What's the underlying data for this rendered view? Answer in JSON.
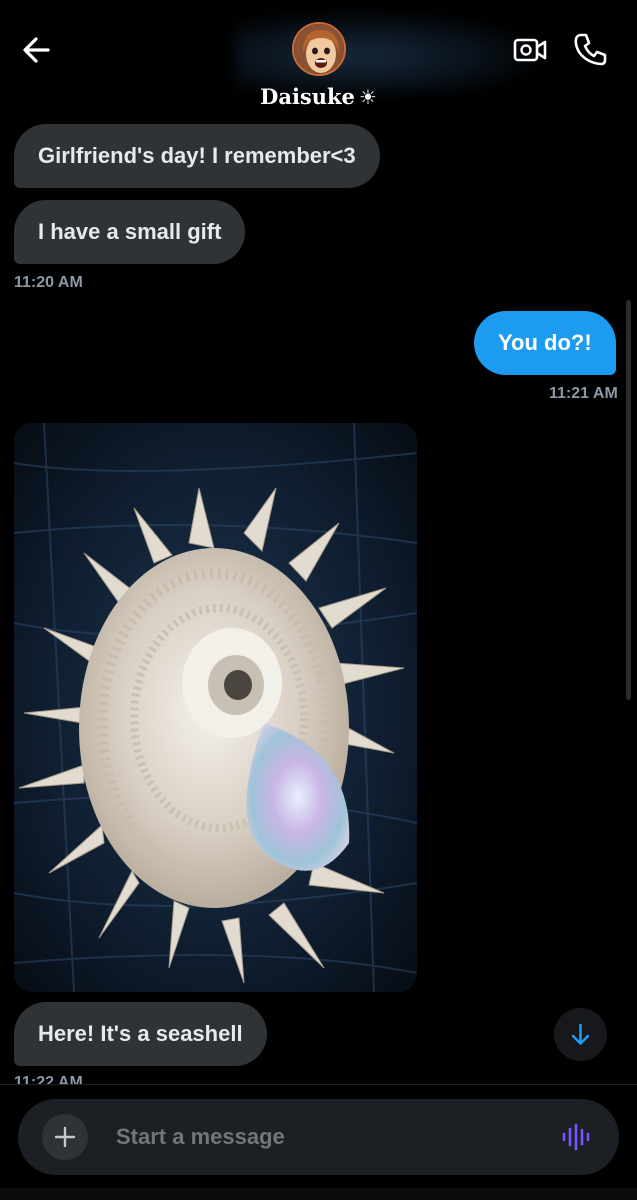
{
  "header": {
    "contact_name": "Daisuke",
    "name_emoji": "☀"
  },
  "messages": [
    {
      "direction": "in",
      "text": "Girlfriend's day! I remember<3"
    },
    {
      "direction": "in",
      "text": "I have a small gift"
    },
    {
      "direction": "in",
      "timestamp": "11:20 AM"
    },
    {
      "direction": "out",
      "text": "You do?!"
    },
    {
      "direction": "out",
      "timestamp": "11:21 AM"
    },
    {
      "direction": "in",
      "media": "spiral seashell photo"
    },
    {
      "direction": "in",
      "text": "Here! It's a seashell"
    },
    {
      "direction": "in",
      "timestamp": "11:22 AM"
    }
  ],
  "composer": {
    "placeholder": "Start a message"
  },
  "icons": {
    "back": "arrow-left-icon",
    "video": "video-camera-icon",
    "call": "phone-icon",
    "add": "plus-icon",
    "voice": "voice-wave-icon",
    "scroll": "arrow-down-icon"
  },
  "colors": {
    "background": "#000000",
    "incoming_bubble": "#2f3336",
    "outgoing_bubble": "#1d9bf0",
    "timestamp": "#8b98a5",
    "voice_accent": "#7856ff"
  }
}
